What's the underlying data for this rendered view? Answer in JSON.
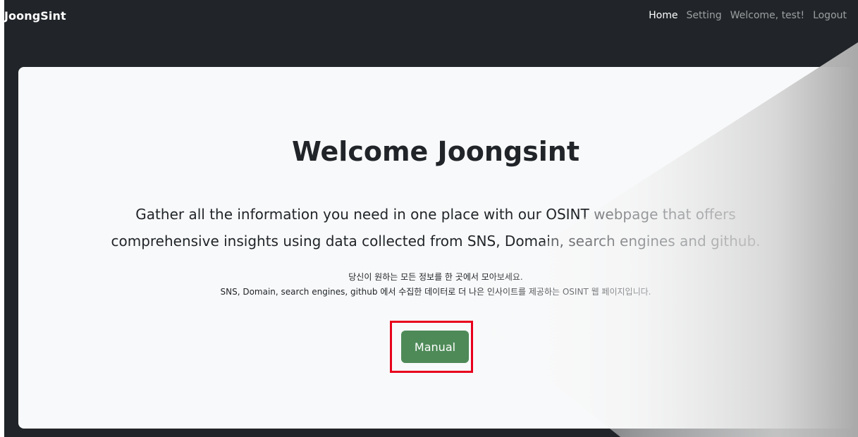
{
  "navbar": {
    "brand": "JoongSint",
    "links": [
      {
        "label": "Home",
        "active": true
      },
      {
        "label": "Setting",
        "active": false
      },
      {
        "label": "Welcome, test!",
        "active": false
      },
      {
        "label": "Logout",
        "active": false
      }
    ]
  },
  "hero": {
    "title": "Welcome Joongsint",
    "lead_line1": "Gather all the information you need in one place with our OSINT webpage that offers",
    "lead_line2": "comprehensive insights using data collected from SNS, Domain, search engines and github.",
    "desc_line1": "당신이 원하는 모든 정보를 한 곳에서 모아보세요.",
    "desc_line2": "SNS, Domain, search engines, github 에서 수집한 데이터로 더 나은 인사이트를 제공하는 OSINT 웹 페이지입니다.",
    "button_label": "Manual"
  },
  "colors": {
    "navbar_bg": "#212529",
    "hero_bg": "#f8f9fa",
    "button_bg": "#4e8a58",
    "highlight_border": "#e8001c"
  }
}
